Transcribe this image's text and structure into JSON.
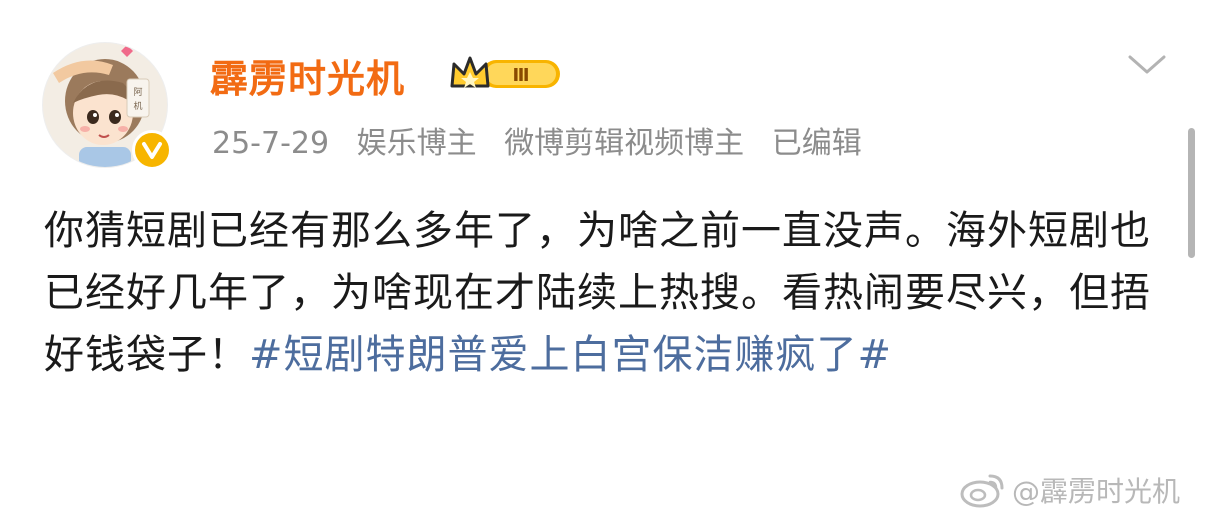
{
  "post": {
    "author": {
      "name": "霹雳时光机",
      "level_badge": "Ⅲ",
      "avatar_text": "阿机"
    },
    "meta": {
      "date": "25-7-29",
      "tags": [
        "娱乐博主",
        "微博剪辑视频博主",
        "已编辑"
      ]
    },
    "body_text": "你猜短剧已经有那么多年了，为啥之前一直没声。海外短剧也已经好几年了，为啥现在才陆续上热搜。看热闹要尽兴，但捂好钱袋子！",
    "topic": "#短剧特朗普爱上白宫保洁赚疯了#"
  },
  "watermark": {
    "text": "@霹雳时光机"
  },
  "colors": {
    "name": "#f26b13",
    "meta": "#8c8c8c",
    "topic": "#4d6d9e",
    "verified": "#f7b500"
  },
  "icons": {
    "menu": "chevron-down-icon",
    "verified": "verified-v-icon",
    "level": "crown-level-icon",
    "watermark": "weibo-logo-icon"
  }
}
